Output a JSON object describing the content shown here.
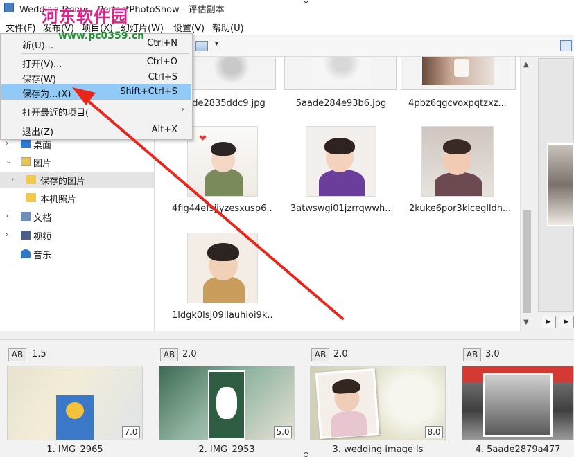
{
  "window": {
    "title": "Wedding-Demo - PerfectPhotoShow - 评估副本"
  },
  "watermark": {
    "text": "河东软件园",
    "url": "www.pc0359.cn"
  },
  "menubar": {
    "items": [
      "文件(F)",
      "发布(V)",
      "项目(X)",
      "幻灯片(W)",
      "设置(V)",
      "帮助(U)"
    ]
  },
  "file_menu": {
    "items": [
      {
        "label": "新(U)...",
        "shortcut": "Ctrl+N"
      },
      {
        "label": "打开(V)...",
        "shortcut": "Ctrl+O"
      },
      {
        "label": "保存(W)",
        "shortcut": "Ctrl+S"
      },
      {
        "label": "保存为...(X)",
        "shortcut": "Shift+Ctrl+S",
        "highlighted": true
      },
      {
        "label": "打开最近的项目(",
        "submenu_glyph": "›"
      },
      {
        "label": "退出(Z)",
        "shortcut": "Alt+X"
      }
    ]
  },
  "folder_tree": {
    "items": [
      {
        "label": "桌面",
        "icon": "desktop-folder-icon"
      },
      {
        "label": "图片",
        "icon": "pictures-folder-icon"
      },
      {
        "label": "保存的图片",
        "icon": "folder-icon",
        "selected": true
      },
      {
        "label": "本机照片",
        "icon": "folder-icon"
      },
      {
        "label": "文档",
        "icon": "documents-folder-icon"
      },
      {
        "label": "视频",
        "icon": "videos-folder-icon"
      },
      {
        "label": "音乐",
        "icon": "music-folder-icon"
      }
    ],
    "arrows": {
      "collapsed": "›",
      "expanded": "⌄"
    }
  },
  "thumbnails": {
    "top_row": [
      "de2835ddc9.jpg",
      "5aade284e93b6.jpg",
      "4pbz6qgcvoxpqtzxz..."
    ],
    "items": [
      {
        "caption": "4fig44efsjjyzesxusp6..."
      },
      {
        "caption": "3atwswgi01jzrrqwwh..."
      },
      {
        "caption": "2kuke6por3klceglldh..."
      },
      {
        "caption": "1ldgk0lsj09llauhioi9k..."
      }
    ]
  },
  "scrollbar": {
    "up": "▲",
    "down": "▼"
  },
  "preview": {
    "play": "▶",
    "next": "▶"
  },
  "storyboard": {
    "transition_label": "AB",
    "slides": [
      {
        "caption": "1. IMG_2965",
        "transition_duration": "1.5",
        "slide_duration": "7.0"
      },
      {
        "caption": "2. IMG_2953",
        "transition_duration": "2.0",
        "slide_duration": "5.0"
      },
      {
        "caption": "3. wedding image ls",
        "transition_duration": "2.0",
        "slide_duration": "8.0"
      },
      {
        "caption": "4. 5aade2879a477",
        "transition_duration": "3.0",
        "slide_duration": ""
      }
    ]
  },
  "toolbar": {
    "dropdown_glyph": "▾"
  },
  "colors": {
    "menu_highlight": "#91c9f7",
    "annotation_arrow": "#e8261c",
    "watermark": "#e0218a",
    "watermark_url": "#1e8f33"
  }
}
